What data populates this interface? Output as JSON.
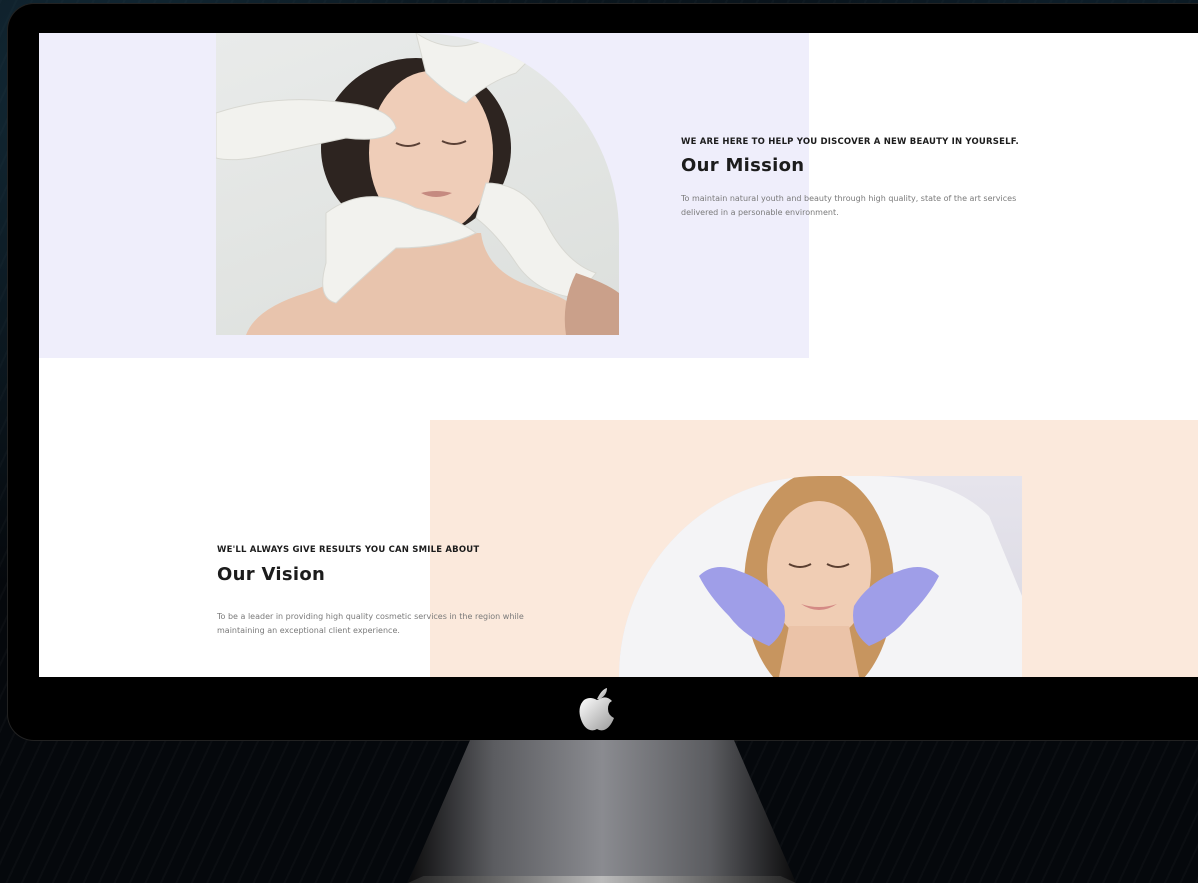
{
  "mission": {
    "eyebrow": "WE ARE HERE TO HELP YOU DISCOVER A NEW BEAUTY IN YOURSELF.",
    "title": "Our Mission",
    "text": "To maintain natural youth and beauty through high quality, state of the art services delivered in a personable environment."
  },
  "vision": {
    "eyebrow": "WE'LL ALWAYS GIVE RESULTS YOU CAN SMILE ABOUT",
    "title": "Our Vision",
    "text": "To be a leader in providing high quality cosmetic services in the region while maintaining an exceptional client experience."
  },
  "colors": {
    "mission_background": "#efeefb",
    "vision_background": "#fbe9dc",
    "glove_white": "#f2f2ee",
    "glove_lavender": "#9f9ee8"
  },
  "icons": {
    "monitor_logo": "apple-logo-icon"
  }
}
